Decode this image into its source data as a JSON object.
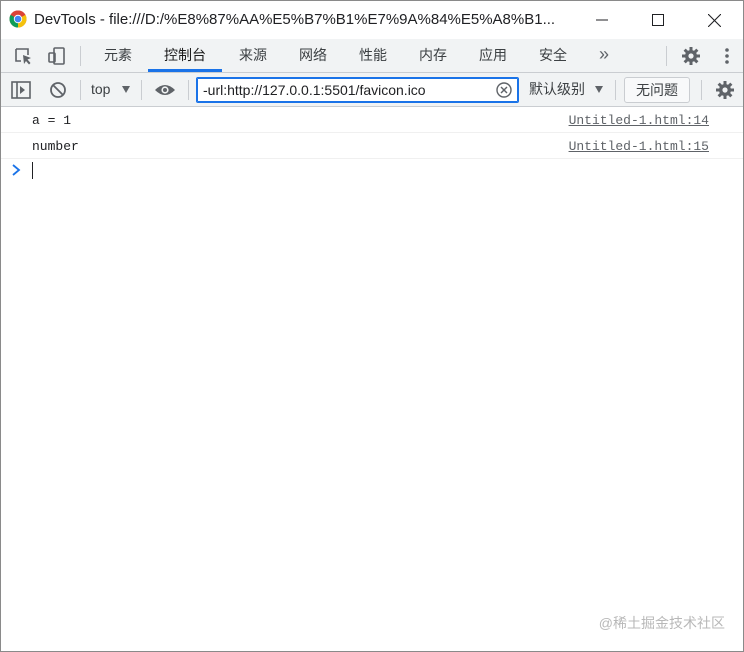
{
  "window": {
    "title": "DevTools - file:///D:/%E8%87%AA%E5%B7%B1%E7%9A%84%E5%A8%B1..."
  },
  "tabs": [
    {
      "label": "元素"
    },
    {
      "label": "控制台",
      "active": true
    },
    {
      "label": "来源"
    },
    {
      "label": "网络"
    },
    {
      "label": "性能"
    },
    {
      "label": "内存"
    },
    {
      "label": "应用"
    },
    {
      "label": "安全"
    }
  ],
  "more_tabs": "»",
  "toolbar": {
    "context": "top",
    "filter_value": "-url:http://127.0.0.1:5501/favicon.ico",
    "levels": "默认级别",
    "issues": "无问题"
  },
  "console": {
    "messages": [
      {
        "text": "a = 1",
        "source": "Untitled-1.html:14"
      },
      {
        "text": "number",
        "source": "Untitled-1.html:15"
      }
    ]
  },
  "watermark": "@稀土掘金技术社区",
  "colors": {
    "accent": "#1a73e8",
    "toolbar_bg": "#f1f3f4",
    "border": "#cacdd1"
  }
}
